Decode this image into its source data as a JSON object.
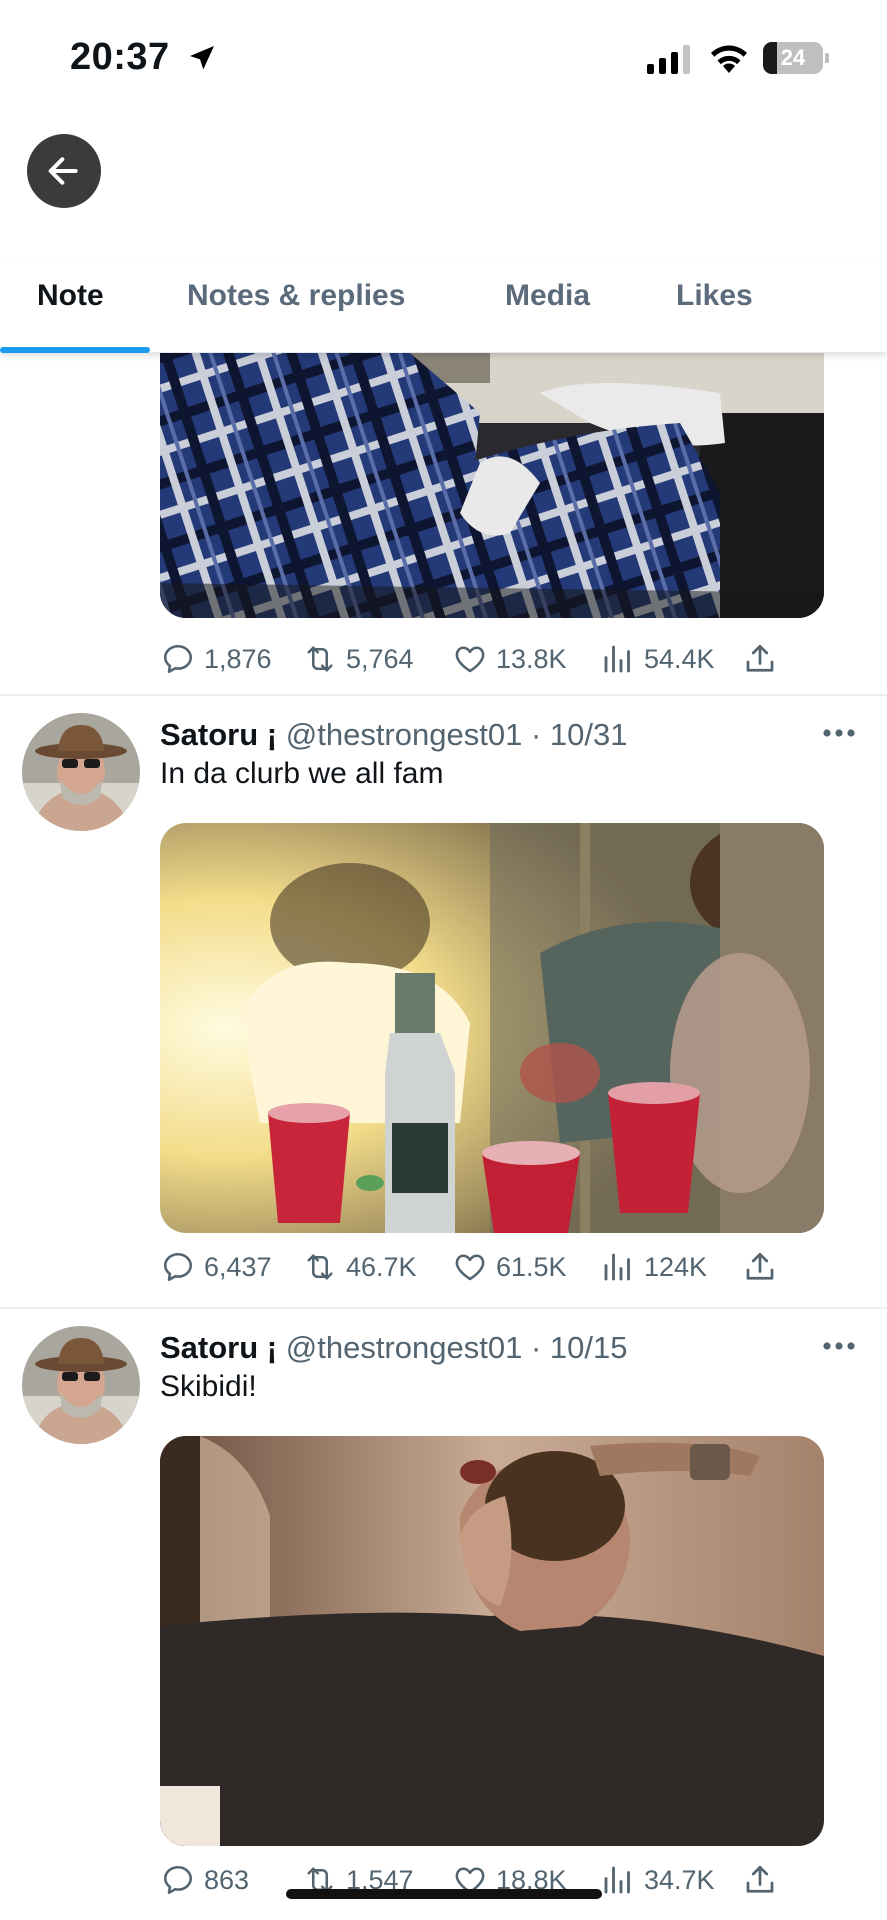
{
  "status_bar": {
    "time": "20:37",
    "battery_level": "24",
    "battery_fraction": 0.24,
    "icons": [
      "location-arrow-icon",
      "cellular-signal-icon",
      "wifi-icon",
      "battery-icon"
    ]
  },
  "header": {
    "back_icon": "arrow-left-icon"
  },
  "tabs": [
    {
      "label": "Note",
      "active": true
    },
    {
      "label": "Notes & replies",
      "active": false
    },
    {
      "label": "Media",
      "active": false
    },
    {
      "label": "Likes",
      "active": false
    }
  ],
  "colors": {
    "accent": "#1d9bf0",
    "text_primary": "#0f1419",
    "text_secondary": "#536471"
  },
  "feed": {
    "top_partial_post": {
      "stats": {
        "replies": "1,876",
        "reposts": "5,764",
        "likes": "13.8K",
        "views": "54.4K"
      }
    },
    "posts": [
      {
        "display_name": "Satoru ¡",
        "handle": "@thestrongest01",
        "separator": "·",
        "date": "10/31",
        "text": "In da clurb we all fam",
        "stats": {
          "replies": "6,437",
          "reposts": "46.7K",
          "likes": "61.5K",
          "views": "124K"
        }
      },
      {
        "display_name": "Satoru ¡",
        "handle": "@thestrongest01",
        "separator": "·",
        "date": "10/15",
        "text": "Skibidi!",
        "stats": {
          "replies": "863",
          "reposts": "1,547",
          "likes": "18.8K",
          "views": "34.7K"
        }
      }
    ]
  }
}
